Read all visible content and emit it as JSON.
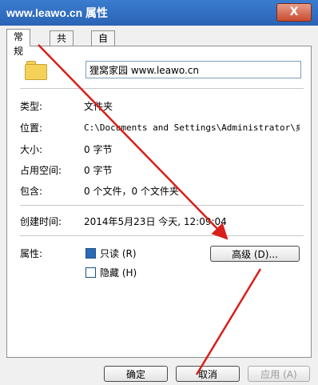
{
  "window": {
    "title": "www.leawo.cn 属性",
    "close_label": "X"
  },
  "tabs": [
    {
      "label": "常规"
    },
    {
      "label": "共享"
    },
    {
      "label": "自定义"
    }
  ],
  "general": {
    "name": "狸窝家园 www.leawo.cn",
    "rows": [
      {
        "label": "类型:",
        "value": "文件夹"
      },
      {
        "label": "位置:",
        "value": "C:\\Documents and Settings\\Administrator\\桌"
      },
      {
        "label": "大小:",
        "value": "0 字节"
      },
      {
        "label": "占用空间:",
        "value": "0 字节"
      },
      {
        "label": "包含:",
        "value": "0 个文件，0 个文件夹"
      },
      {
        "label": "创建时间:",
        "value": "2014年5月23日  今天, 12:09:04"
      }
    ],
    "attributes_label": "属性:",
    "readonly_label": "只读 (R)",
    "hidden_label": "隐藏 (H)",
    "advanced_label": "高级 (D)..."
  },
  "footer": {
    "ok_label": "确定",
    "cancel_label": "取消",
    "apply_label": "应用 (A)"
  },
  "colors": {
    "titlebar": "#2a63b5",
    "arrow": "#d8201a",
    "checkbox_checked": "#2b6ab8"
  }
}
